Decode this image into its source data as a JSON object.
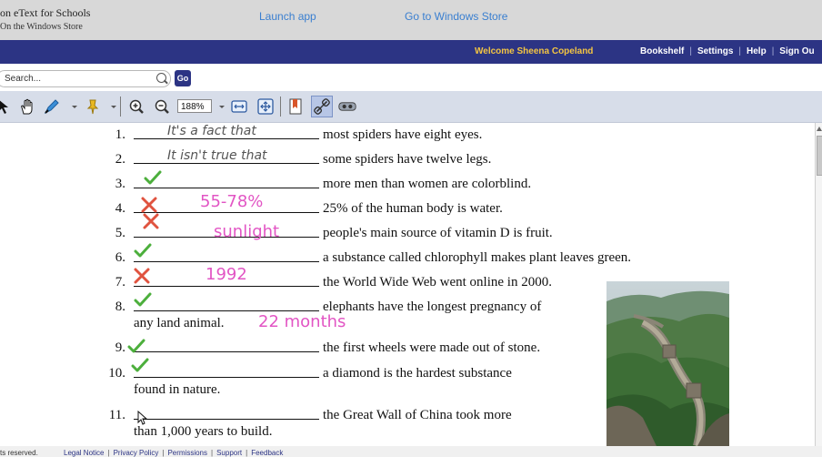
{
  "header": {
    "brand_line1": "on eText for Schools",
    "brand_line2": "On the Windows Store",
    "launch_app": "Launch app",
    "windows_store": "Go to Windows Store"
  },
  "navbar": {
    "welcome": "Welcome Sheena Copeland",
    "links": [
      "Bookshelf",
      "Settings",
      "Help",
      "Sign Ou"
    ]
  },
  "search": {
    "placeholder": "Search...",
    "go_label": "Go"
  },
  "toolbar": {
    "zoom": "188%",
    "icons": [
      "pointer-icon",
      "hand-icon",
      "highlighter-icon",
      "sticky-note-icon",
      "zoom-in-icon",
      "zoom-out-icon",
      "fit-width-icon",
      "fit-page-icon",
      "bookmark-icon",
      "link-icon",
      "audio-icon"
    ]
  },
  "worksheet": {
    "items": [
      {
        "n": "1.",
        "text": "most spiders have eight eyes.",
        "answer": "It's a fact that",
        "mark": ""
      },
      {
        "n": "2.",
        "text": "some spiders have twelve legs.",
        "answer": "It isn't true that",
        "mark": ""
      },
      {
        "n": "3.",
        "text": "more men than women are colorblind.",
        "answer": "",
        "mark": "check"
      },
      {
        "n": "4.",
        "text": "25% of the human body is water.",
        "answer": "55-78%",
        "mark": "cross"
      },
      {
        "n": "5.",
        "text": "people's main source of vitamin D is fruit.",
        "answer": "sunlight",
        "mark": "cross"
      },
      {
        "n": "6.",
        "text": "a substance called chlorophyll makes plant leaves green.",
        "answer": "",
        "mark": "check"
      },
      {
        "n": "7.",
        "text": "the World Wide Web went online in 2000.",
        "answer": "1992",
        "mark": "cross"
      },
      {
        "n": "8.",
        "text": "elephants have the longest pregnancy of",
        "text2": "any land animal.",
        "answer": "22 months",
        "mark": "check"
      },
      {
        "n": "9.",
        "text": "the first wheels were made out of stone.",
        "answer": "",
        "mark": "check"
      },
      {
        "n": "10.",
        "text": "a diamond is the hardest substance",
        "text2": "found in nature.",
        "answer": "",
        "mark": "check"
      },
      {
        "n": "11.",
        "text": "the Great Wall of China took more",
        "text2": "than 1,000 years to build.",
        "answer": "",
        "mark": ""
      }
    ]
  },
  "footer": {
    "rights": "ts reserved.",
    "links": [
      "Legal Notice",
      "Privacy Policy",
      "Permissions",
      "Support",
      "Feedback"
    ]
  },
  "colors": {
    "navbar": "#2c3484",
    "welcome": "#f4c542",
    "link": "#3a7fd0",
    "check": "#4caf3c",
    "cross": "#e0533f",
    "pink_ink": "#e255c4"
  }
}
